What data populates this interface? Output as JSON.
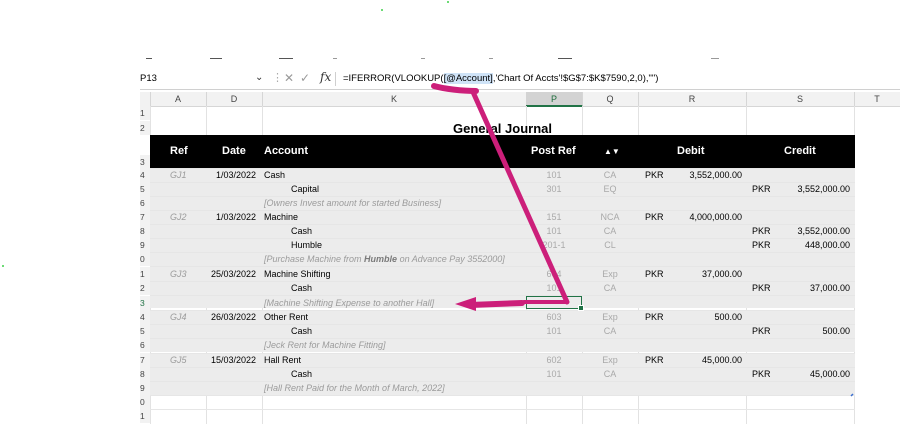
{
  "formula_bar": {
    "name_box": "P13",
    "formula_prefix": "=IFERROR(VLOOKUP(",
    "formula_highlight": "[@Account]",
    "formula_suffix": ",'Chart Of Accts'!$G$7:$K$7590,2,0),\"\")",
    "fx": "fx",
    "cancel": "✕",
    "confirm": "✓"
  },
  "columns": [
    "A",
    "D",
    "K",
    "P",
    "Q",
    "R",
    "S",
    "T"
  ],
  "rows": [
    "1",
    "2",
    "3",
    "4",
    "5",
    "6",
    "7",
    "8",
    "9",
    "0",
    "1",
    "2",
    "3",
    "4",
    "5",
    "6",
    "7",
    "8",
    "9",
    "0",
    "1"
  ],
  "sheet": {
    "title": "General Journal",
    "headers": {
      "ref": "Ref",
      "date": "Date",
      "account": "Account",
      "post_ref": "Post Ref",
      "sort": "▲▼",
      "debit": "Debit",
      "credit": "Credit"
    }
  },
  "entries": [
    {
      "ref": "GJ1",
      "date": "1/03/2022",
      "account": "Cash",
      "post": "101",
      "q": "CA",
      "cur_dr": "PKR",
      "debit": "3,552,000.00"
    },
    {
      "account": "Capital",
      "post": "301",
      "q": "EQ",
      "cur_cr": "PKR",
      "credit": "3,552,000.00"
    },
    {
      "note": "[Owners Invest amount for started Business]"
    },
    {
      "ref": "GJ2",
      "date": "1/03/2022",
      "account": "Machine",
      "post": "151",
      "q": "NCA",
      "cur_dr": "PKR",
      "debit": "4,000,000.00"
    },
    {
      "account": "Cash",
      "post": "101",
      "q": "CA",
      "cur_cr": "PKR",
      "credit": "3,552,000.00"
    },
    {
      "account": "Humble",
      "post": "201-1",
      "q": "CL",
      "cur_cr": "PKR",
      "credit": "448,000.00"
    },
    {
      "note_a": "[Purchase Machine from ",
      "note_b": "Humble",
      "note_c": " on Advance Pay 3552000]"
    },
    {
      "ref": "GJ3",
      "date": "25/03/2022",
      "account": "Machine Shifting",
      "post": "604",
      "q": "Exp",
      "cur_dr": "PKR",
      "debit": "37,000.00"
    },
    {
      "account": "Cash",
      "post": "101",
      "q": "CA",
      "cur_cr": "PKR",
      "credit": "37,000.00"
    },
    {
      "note": "[Machine Shifting Expense to another Hall]"
    },
    {
      "ref": "GJ4",
      "date": "26/03/2022",
      "account": "Other Rent",
      "post": "603",
      "q": "Exp",
      "cur_dr": "PKR",
      "debit": "500.00"
    },
    {
      "account": "Cash",
      "post": "101",
      "q": "CA",
      "cur_cr": "PKR",
      "credit": "500.00"
    },
    {
      "note": "[Jeck Rent for Machine Fitting]"
    },
    {
      "ref": "GJ5",
      "date": "15/03/2022",
      "account": "Hall Rent",
      "post": "602",
      "q": "Exp",
      "cur_dr": "PKR",
      "debit": "45,000.00"
    },
    {
      "account": "Cash",
      "post": "101",
      "q": "CA",
      "cur_cr": "PKR",
      "credit": "45,000.00"
    },
    {
      "note": "[Hall Rent Paid for the Month of March, 2022]"
    }
  ],
  "colors": {
    "selection": "#217346",
    "annotation": "#cc1f7a",
    "header_band": "#000000",
    "row_band": "#ececec"
  }
}
